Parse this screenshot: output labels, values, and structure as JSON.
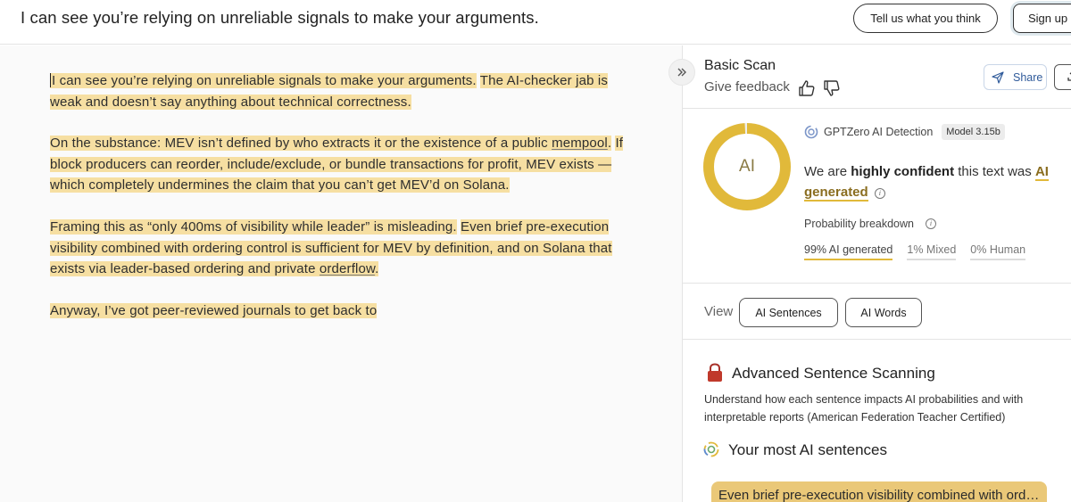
{
  "header": {
    "doc_title": "I can see you’re relying on unreliable signals to make your arguments.",
    "feedback_label": "Tell us what you think",
    "signup_label": "Sign up"
  },
  "editor": {
    "p1": {
      "s1": "I can see you’re relying on unreliable signals to make your arguments.",
      "s2": "The AI-checker jab is weak and doesn’t say anything about technical correctness."
    },
    "p2": {
      "s1a": "On the substance: MEV isn’t defined by who extracts it or the existence of a public ",
      "s1b": "mempool",
      "s1c": ".",
      "s2": "If block producers can reorder, include/exclude, or bundle transactions for profit, MEV exists — which completely undermines the claim that you can’t get MEV’d on Solana."
    },
    "p3": {
      "s1": "Framing this as “only 400ms of visibility while leader” is misleading.",
      "s2a": "Even brief pre-execution visibility combined with ordering control is sufficient for MEV by definition, and on Solana that exists via leader-based ordering and private ",
      "s2b": "orderflow",
      "s2c": "."
    },
    "p4": {
      "s1": "Anyway, I’ve got peer-reviewed journals to get back to"
    }
  },
  "panel": {
    "scan_title": "Basic Scan",
    "give_feedback": "Give feedback",
    "share_label": "Share",
    "donut_label": "AI",
    "ai_probability": 0.99,
    "detector_name": "GPTZero AI Detection",
    "model_badge": "Model 3.15b",
    "verdict": {
      "prefix": "We are ",
      "confidence": "highly confident",
      "middle": " this text was ",
      "result": "AI generated"
    },
    "probability_title": "Probability breakdown",
    "probabilities": {
      "ai": "99% AI generated",
      "mixed": "1% Mixed",
      "human": "0% Human"
    },
    "view_label": "View",
    "view_sentences": "AI Sentences",
    "view_words": "AI Words",
    "advanced_title": "Advanced Sentence Scanning",
    "advanced_desc": "Understand how each sentence impacts AI probabilities and with interpretable reports (American Federation Teacher Certified)",
    "most_ai_title": "Your most AI sentences",
    "top_sentence": "Even brief pre-execution visibility combined with ordering control is sufficient for MEV by definition"
  },
  "colors": {
    "highlight": "#f6dfa2",
    "donut": "#e1b93a",
    "card": "#eac878",
    "lock": "#c0392b"
  }
}
